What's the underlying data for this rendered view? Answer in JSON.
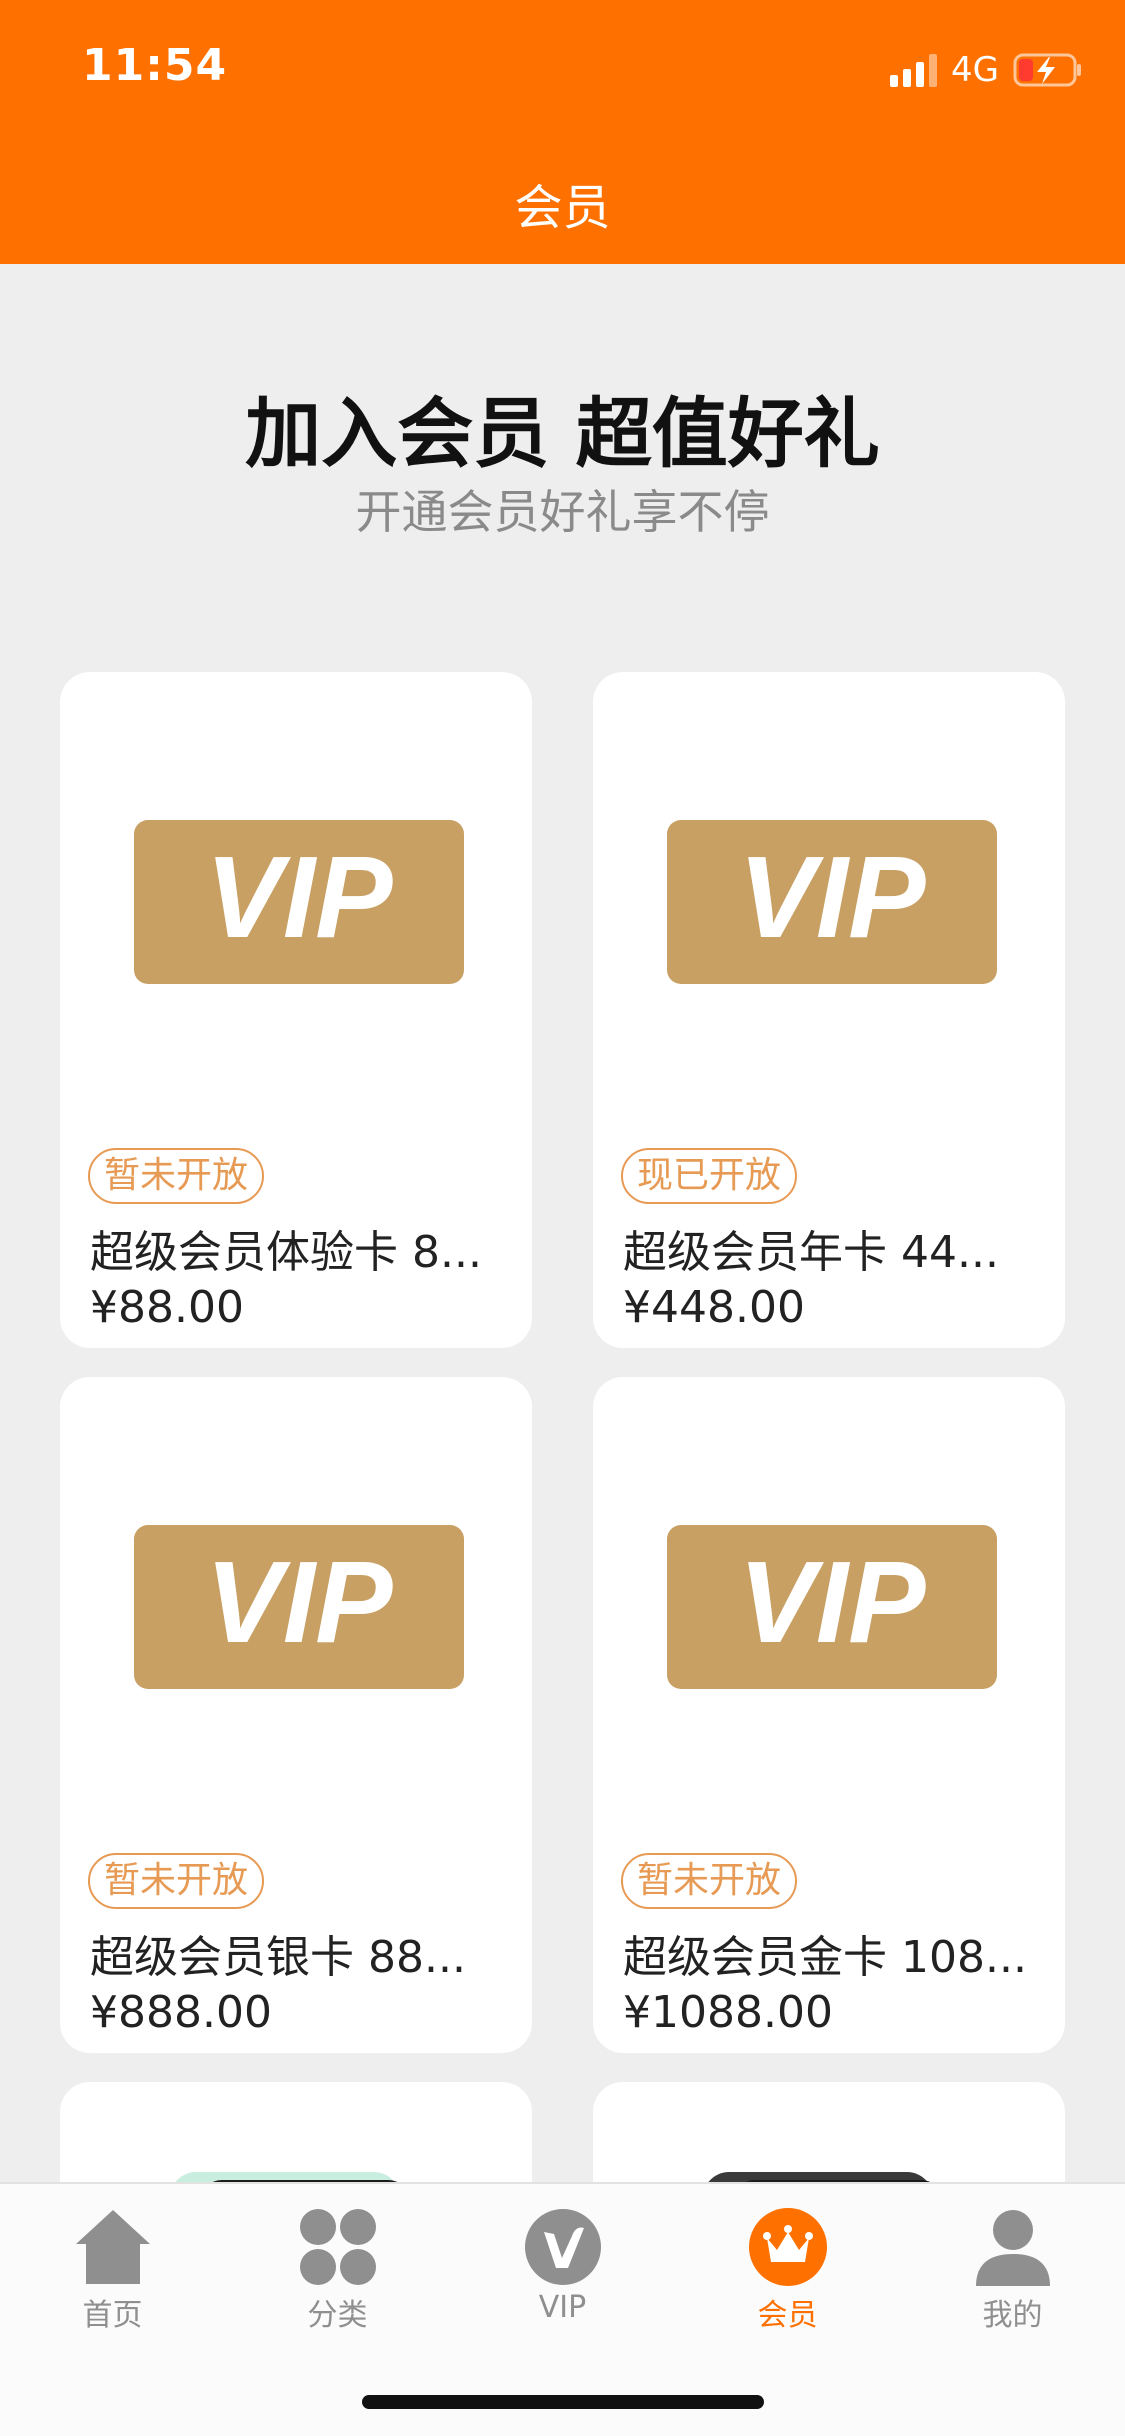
{
  "status_bar": {
    "time": "11:54",
    "network": "4G"
  },
  "nav": {
    "title": "会员"
  },
  "hero": {
    "title": "加入会员 超值好礼",
    "subtitle": "开通会员好礼享不停"
  },
  "vip_logo_text": "VIP",
  "cards": [
    {
      "badge": "暂未开放",
      "name": "超级会员体验卡 8...",
      "price": "¥88.00"
    },
    {
      "badge": "现已开放",
      "name": "超级会员年卡 44...",
      "price": "¥448.00"
    },
    {
      "badge": "暂未开放",
      "name": "超级会员银卡 88...",
      "price": "¥888.00"
    },
    {
      "badge": "暂未开放",
      "name": "超级会员金卡 108...",
      "price": "¥1088.00"
    }
  ],
  "tabs": [
    {
      "label": "首页",
      "icon": "home-icon",
      "active": false
    },
    {
      "label": "分类",
      "icon": "category-icon",
      "active": false
    },
    {
      "label": "VIP",
      "icon": "vip-icon",
      "active": false
    },
    {
      "label": "会员",
      "icon": "crown-icon",
      "active": true
    },
    {
      "label": "我的",
      "icon": "user-icon",
      "active": false
    }
  ],
  "colors": {
    "accent": "#fe7100",
    "vip_gold": "#c9a064",
    "badge_orange": "#e79a54",
    "background": "#eeeeee",
    "tab_inactive": "#8f8f8f"
  }
}
